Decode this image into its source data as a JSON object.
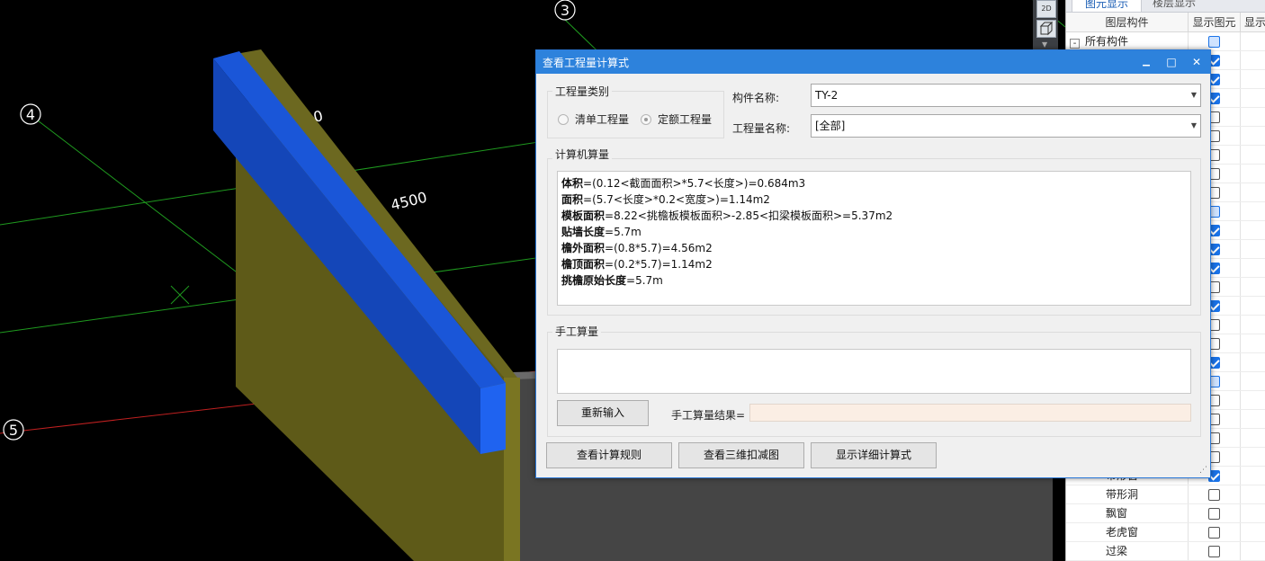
{
  "viewport": {
    "axis_labels": [
      "3",
      "4",
      "5"
    ],
    "dimension_labels": [
      "4500",
      "0"
    ]
  },
  "layer_panel": {
    "tabs": [
      "图元显示",
      "楼层显示"
    ],
    "columns": [
      "图层构件",
      "显示图元",
      "显示"
    ],
    "rows": [
      {
        "name": "所有构件",
        "state": "partial",
        "root": true
      },
      {
        "name": "",
        "state": "checked"
      },
      {
        "name": "",
        "state": "checked"
      },
      {
        "name": "",
        "state": "checked"
      },
      {
        "name": "",
        "state": "unchecked"
      },
      {
        "name": "",
        "state": "unchecked"
      },
      {
        "name": "",
        "state": "unchecked"
      },
      {
        "name": "",
        "state": "unchecked"
      },
      {
        "name": "",
        "state": "unchecked"
      },
      {
        "name": "",
        "state": "partial"
      },
      {
        "name": "",
        "state": "checked"
      },
      {
        "name": "",
        "state": "checked"
      },
      {
        "name": "",
        "state": "checked"
      },
      {
        "name": "",
        "state": "unchecked"
      },
      {
        "name": "",
        "state": "checked"
      },
      {
        "name": "",
        "state": "unchecked"
      },
      {
        "name": "",
        "state": "unchecked"
      },
      {
        "name": "",
        "state": "checked"
      },
      {
        "name": "",
        "state": "partial"
      },
      {
        "name": "",
        "state": "unchecked"
      },
      {
        "name": "",
        "state": "unchecked"
      },
      {
        "name": "",
        "state": "unchecked"
      },
      {
        "name": "",
        "state": "unchecked"
      },
      {
        "name": "带形窗",
        "state": "checked"
      },
      {
        "name": "带形洞",
        "state": "unchecked"
      },
      {
        "name": "飘窗",
        "state": "unchecked"
      },
      {
        "name": "老虎窗",
        "state": "unchecked"
      },
      {
        "name": "过梁",
        "state": "unchecked"
      }
    ]
  },
  "dialog": {
    "title": "查看工程量计算式",
    "window_buttons": {
      "minimize": "▁",
      "maximize": "□",
      "close": "✕"
    },
    "category": {
      "legend": "工程量类别",
      "option_bill": "清单工程量",
      "option_quota": "定额工程量",
      "selected": "quota"
    },
    "component_name_label": "构件名称:",
    "component_name_value": "TY-2",
    "quantity_name_label": "工程量名称:",
    "quantity_name_value": "[全部]",
    "computer_calc": {
      "legend": "计算机算量",
      "lines": [
        {
          "name": "体积",
          "formula": "=(0.12<截面面积>*5.7<长度>)=0.684m3"
        },
        {
          "name": "面积",
          "formula": "=(5.7<长度>*0.2<宽度>)=1.14m2"
        },
        {
          "name": "模板面积",
          "formula": "=8.22<挑檐板模板面积>-2.85<扣梁模板面积>=5.37m2"
        },
        {
          "name": "贴墙长度",
          "formula": "=5.7m"
        },
        {
          "name": "檐外面积",
          "formula": "=(0.8*5.7)=4.56m2"
        },
        {
          "name": "檐顶面积",
          "formula": "=(0.2*5.7)=1.14m2"
        },
        {
          "name": "挑檐原始长度",
          "formula": "=5.7m"
        }
      ]
    },
    "manual_calc": {
      "legend": "手工算量",
      "reenter_button": "重新输入",
      "result_label": "手工算量结果=",
      "result_value": ""
    },
    "buttons": {
      "view_rules": "查看计算规则",
      "view_3d_deduction": "查看三维扣减图",
      "show_detailed": "显示详细计算式"
    }
  },
  "colors": {
    "title_bar": "#2d82dc",
    "wall": "#5e5a18",
    "eave_blue": "#1a55d6",
    "grid_green": "#22aa22",
    "grid_red": "#cc2222"
  }
}
